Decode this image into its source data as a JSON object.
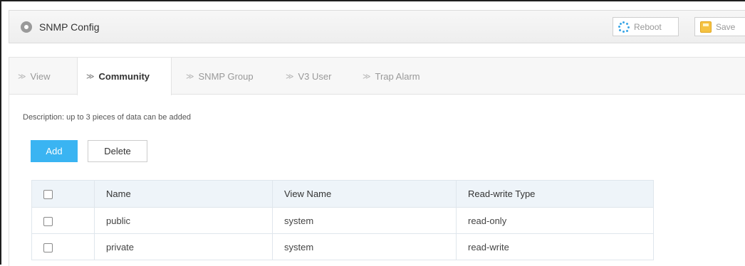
{
  "header": {
    "title": "SNMP Config",
    "reboot_label": "Reboot",
    "save_label": "Save"
  },
  "tabs": [
    {
      "label": "View",
      "active": false
    },
    {
      "label": "Community",
      "active": true
    },
    {
      "label": "SNMP Group",
      "active": false
    },
    {
      "label": "V3 User",
      "active": false
    },
    {
      "label": "Trap Alarm",
      "active": false
    }
  ],
  "content": {
    "description": "Description: up to 3 pieces of data can be added",
    "add_label": "Add",
    "delete_label": "Delete"
  },
  "table": {
    "columns": [
      "Name",
      "View Name",
      "Read-write Type"
    ],
    "rows": [
      {
        "name": "public",
        "view_name": "system",
        "rw_type": "read-only"
      },
      {
        "name": "private",
        "view_name": "system",
        "rw_type": "read-write"
      }
    ]
  },
  "colors": {
    "accent": "#3ab4f2",
    "table_header_bg": "#eef4f9"
  },
  "icons": {
    "header_logo": "settings-circle-icon",
    "reboot": "reboot-spinner-icon",
    "save": "save-icon",
    "tab_arrow": "chevron-right-icon"
  }
}
